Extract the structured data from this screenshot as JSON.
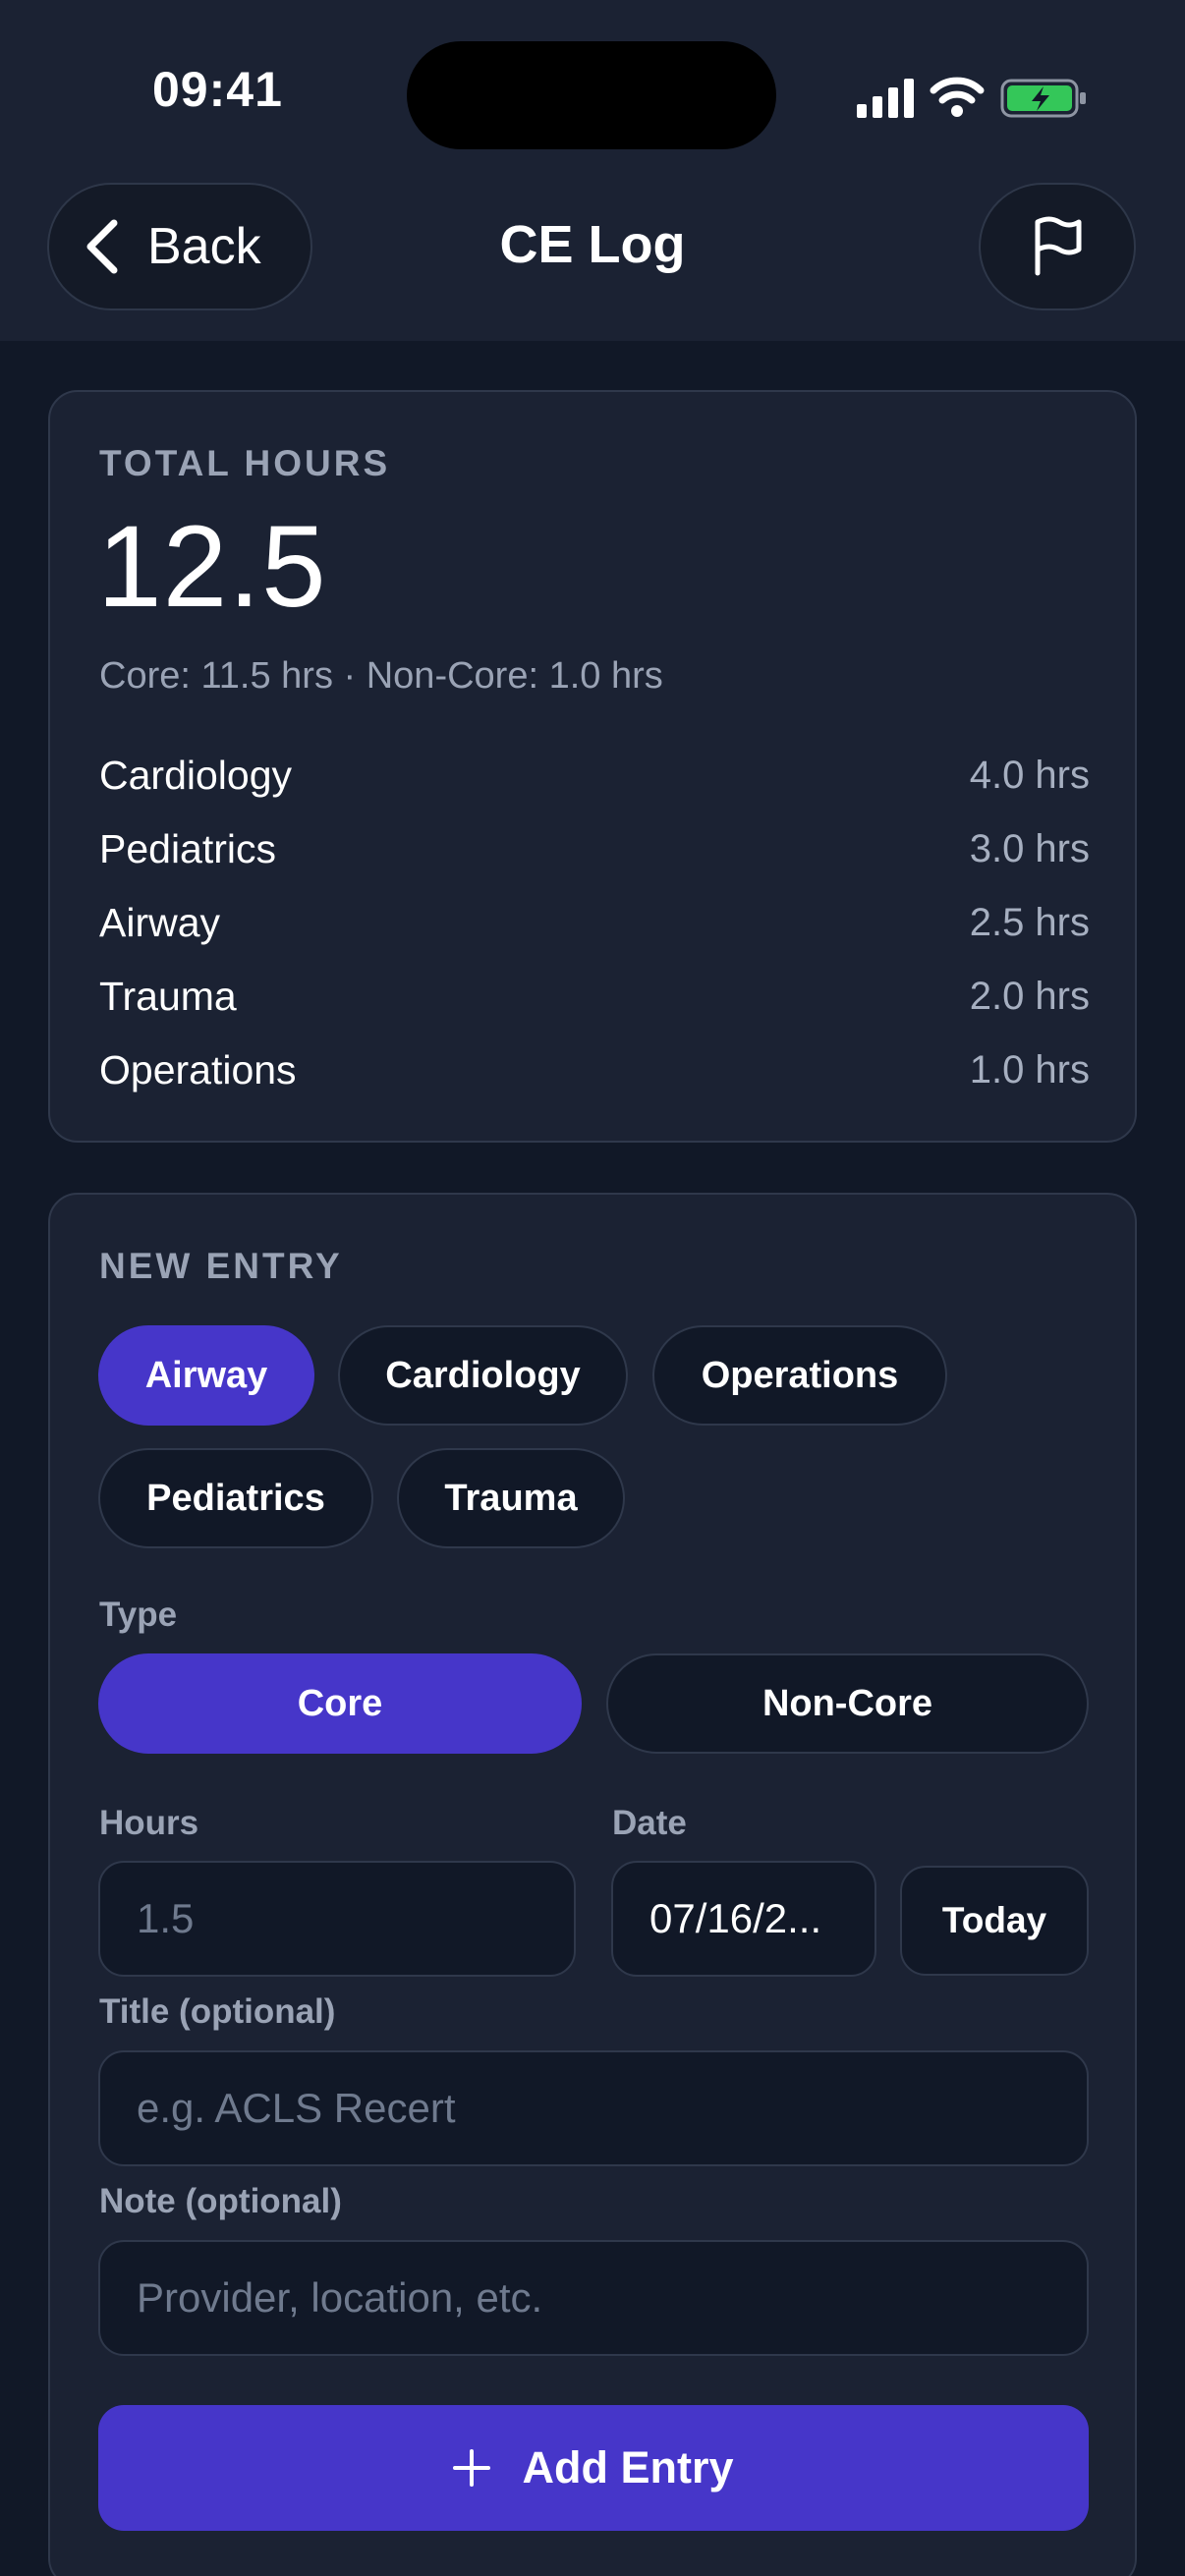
{
  "status_bar": {
    "time": "09:41"
  },
  "header": {
    "back_label": "Back",
    "title": "CE Log"
  },
  "summary": {
    "section_label": "TOTAL HOURS",
    "total": "12.5",
    "breakdown": "Core: 11.5 hrs · Non-Core: 1.0 hrs",
    "categories": [
      {
        "name": "Cardiology",
        "hours": "4.0 hrs"
      },
      {
        "name": "Pediatrics",
        "hours": "3.0 hrs"
      },
      {
        "name": "Airway",
        "hours": "2.5 hrs"
      },
      {
        "name": "Trauma",
        "hours": "2.0 hrs"
      },
      {
        "name": "Operations",
        "hours": "1.0 hrs"
      }
    ]
  },
  "new_entry": {
    "section_label": "NEW ENTRY",
    "chips": [
      "Airway",
      "Cardiology",
      "Operations",
      "Pediatrics",
      "Trauma"
    ],
    "selected_chip": "Airway",
    "type_label": "Type",
    "type_options": [
      "Core",
      "Non-Core"
    ],
    "selected_type": "Core",
    "hours_label": "Hours",
    "hours_placeholder": "1.5",
    "date_label": "Date",
    "date_value": "07/16/2...",
    "today_label": "Today",
    "title_label": "Title (optional)",
    "title_placeholder": "e.g. ACLS Recert",
    "note_label": "Note (optional)",
    "note_placeholder": "Provider, location, etc.",
    "add_label": "Add Entry"
  },
  "colors": {
    "accent": "#4636c9",
    "background": "#111827",
    "card": "#1b2233",
    "battery": "#34c759"
  },
  "icons": [
    "back-chevron-icon",
    "flag-icon",
    "plus-icon",
    "signal-icon",
    "wifi-icon",
    "battery-charging-icon"
  ]
}
